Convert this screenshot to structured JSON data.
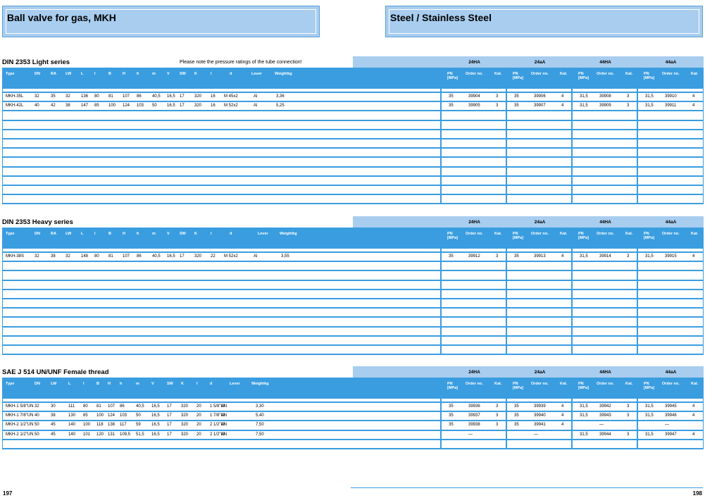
{
  "title_left": "Ball valve for gas, MKH",
  "title_right": "Steel / Stainless Steel",
  "page_left": "197",
  "page_right": "198",
  "groups": [
    "24HA",
    "24aA",
    "44HA",
    "44aA"
  ],
  "group_cols": {
    "pn": "PN [MPa]",
    "order": "Order no.",
    "kat": "Kat."
  },
  "sections": [
    {
      "title": "DIN 2353 Light series",
      "note": "Please note the pressure ratings of the tube connection!",
      "cols": [
        "Type",
        "DN",
        "RA",
        "LW",
        "L",
        "l",
        "B",
        "H",
        "h",
        "m",
        "V",
        "SW",
        "K",
        "l",
        "d",
        "Lever",
        "Weightkg"
      ],
      "rows": [
        {
          "cells": [
            "MKH-35L",
            "32",
            "35",
            "32",
            "136",
            "80",
            "81",
            "107",
            "86",
            "40,5",
            "16,5",
            "17",
            "320",
            "16",
            "M 45x2",
            "Al",
            "3,36"
          ],
          "groups": [
            [
              "35",
              "39904",
              "3"
            ],
            [
              "35",
              "39906",
              "4"
            ],
            [
              "31,5",
              "39908",
              "3"
            ],
            [
              "31,5",
              "39910",
              "4"
            ]
          ]
        },
        {
          "cells": [
            "MKH-42L",
            "40",
            "42",
            "38",
            "147",
            "85",
            "100",
            "124",
            "103",
            "50",
            "16,5",
            "17",
            "320",
            "16",
            "M 52x2",
            "Al",
            "5,25"
          ],
          "groups": [
            [
              "35",
              "39905",
              "3"
            ],
            [
              "35",
              "39907",
              "4"
            ],
            [
              "31,5",
              "39909",
              "3"
            ],
            [
              "31,5",
              "39911",
              "4"
            ]
          ]
        }
      ],
      "empty_rows": 10
    },
    {
      "title": "DIN 2353 Heavy series",
      "note": "",
      "cols": [
        "Type",
        "DN",
        "RA",
        "LW",
        "L",
        "l",
        "B",
        "H",
        "h",
        "m",
        "V",
        "SW",
        "K",
        "l",
        "d",
        "Lever",
        "Weightkg"
      ],
      "rows": [
        {
          "cells": [
            "MKH-38S",
            "32",
            "38",
            "32",
            "148",
            "80",
            "81",
            "107",
            "86",
            "40,5",
            "16,5",
            "17",
            "320",
            "22",
            "M 52x2",
            "Al",
            "3,55"
          ],
          "groups": [
            [
              "35",
              "39912",
              "3"
            ],
            [
              "35",
              "39913",
              "4"
            ],
            [
              "31,5",
              "39914",
              "3"
            ],
            [
              "31,5",
              "39915",
              "4"
            ]
          ]
        }
      ],
      "empty_rows": 10
    },
    {
      "title": "SAE J 514 UN/UNF Female thread",
      "note": "",
      "cols": [
        "Type",
        "DN",
        "LW",
        "L",
        "l",
        "B",
        "H",
        "h",
        "m",
        "V",
        "SW",
        "K",
        "l",
        "d",
        "Lever",
        "Weightkg"
      ],
      "rows": [
        {
          "cells": [
            "MKH-1 5/8\"UN",
            "32",
            "30",
            "111",
            "80",
            "81",
            "107",
            "86",
            "40,5",
            "16,5",
            "17",
            "320",
            "20",
            "1 5/8\"UN",
            "Al",
            "3,30"
          ],
          "groups": [
            [
              "35",
              "39936",
              "3"
            ],
            [
              "35",
              "39939",
              "4"
            ],
            [
              "31,5",
              "39942",
              "3"
            ],
            [
              "31,5",
              "39945",
              "4"
            ]
          ]
        },
        {
          "cells": [
            "MKH-1 7/8\"UN",
            "40",
            "38",
            "130",
            "85",
            "100",
            "124",
            "103",
            "50",
            "16,5",
            "17",
            "320",
            "20",
            "1 7/8\"UN",
            "Al",
            "5,40"
          ],
          "groups": [
            [
              "35",
              "39937",
              "3"
            ],
            [
              "35",
              "39940",
              "4"
            ],
            [
              "31,5",
              "39943",
              "3"
            ],
            [
              "31,5",
              "39946",
              "4"
            ]
          ]
        },
        {
          "cells": [
            "MKH-2 1/2\"UN",
            "50",
            "45",
            "140",
            "100",
            "118",
            "138",
            "117",
            "59",
            "16,5",
            "17",
            "320",
            "20",
            "2 1/2\"UN",
            "Al",
            "7,50"
          ],
          "groups": [
            [
              "35",
              "39938",
              "3"
            ],
            [
              "35",
              "39941",
              "4"
            ],
            [
              "",
              "—",
              ""
            ],
            [
              "",
              "—",
              ""
            ]
          ]
        },
        {
          "cells": [
            "MKH-2 1/2\"UN",
            "50",
            "45",
            "140",
            "101",
            "120",
            "131",
            "109,5",
            "51,5",
            "16,5",
            "17",
            "320",
            "20",
            "2 1/2\"UN",
            "Al",
            "7,50"
          ],
          "groups": [
            [
              "",
              "—",
              ""
            ],
            [
              "",
              "—",
              ""
            ],
            [
              "31,5",
              "39944",
              "3"
            ],
            [
              "31,5",
              "39947",
              "4"
            ]
          ]
        }
      ],
      "empty_rows": 1
    }
  ]
}
